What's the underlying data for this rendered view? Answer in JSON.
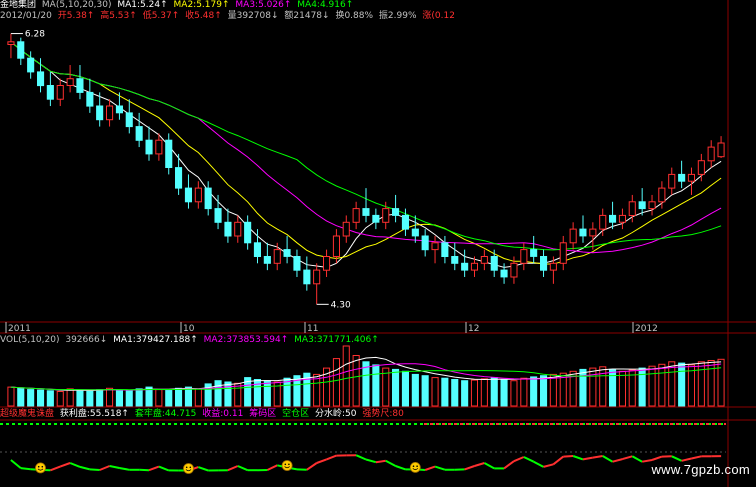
{
  "header": {
    "stock_name": "金地集团",
    "ma_label": "MA(5,10,20,30)",
    "ma_values": [
      {
        "text": "MA1:5.24↑",
        "color": "#ffffff"
      },
      {
        "text": "MA2:5.179↑",
        "color": "#ffff00"
      },
      {
        "text": "MA3:5.026↑",
        "color": "#ff00ff"
      },
      {
        "text": "MA4:4.916↑",
        "color": "#00ff00"
      }
    ]
  },
  "quote": {
    "date": "2012/01/20",
    "fields": [
      {
        "text": "开5.38↑",
        "color": "#ff3030"
      },
      {
        "text": "高5.53↑",
        "color": "#ff3030"
      },
      {
        "text": "低5.37↑",
        "color": "#ff3030"
      },
      {
        "text": "收5.48↑",
        "color": "#ff3030"
      },
      {
        "text": "量392708↓",
        "color": "#c0c0c0"
      },
      {
        "text": "额21478↓",
        "color": "#c0c0c0"
      },
      {
        "text": "换0.88%",
        "color": "#c0c0c0"
      },
      {
        "text": "振2.99%",
        "color": "#c0c0c0"
      },
      {
        "text": "涨(0.12",
        "color": "#ff3030"
      }
    ]
  },
  "price_annotations": {
    "high": "6.28",
    "low": "4.30"
  },
  "x_axis_labels": [
    {
      "text": "2011",
      "color": "#c0c0c0"
    },
    {
      "text": "10",
      "color": "#c0c0c0"
    },
    {
      "text": "11",
      "color": "#c0c0c0"
    },
    {
      "text": "12",
      "color": "#c0c0c0"
    },
    {
      "text": "2012",
      "color": "#c0c0c0"
    }
  ],
  "volume_header": {
    "label": "VOL(5,10,20)",
    "value": "392666↓",
    "ma_values": [
      {
        "text": "MA1:379427.188↑",
        "color": "#ffffff"
      },
      {
        "text": "MA2:373853.594↑",
        "color": "#ff00ff"
      },
      {
        "text": "MA3:371771.406↑",
        "color": "#00ff00"
      }
    ]
  },
  "indicator_header": {
    "items": [
      {
        "text": "超级魔鬼诛盘",
        "color": "#ff3030"
      },
      {
        "text": "获利盘:55.518↑",
        "color": "#ffffff"
      },
      {
        "text": "套牢盘:44.715",
        "color": "#00ff00"
      },
      {
        "text": "收益:0.11",
        "color": "#ff00ff"
      },
      {
        "text": "筹码区",
        "color": "#ff00ff"
      },
      {
        "text": "空仓区",
        "color": "#00ff00"
      },
      {
        "text": "分水岭:50",
        "color": "#ffffff"
      },
      {
        "text": "强势尺:80",
        "color": "#ff3030"
      }
    ]
  },
  "colors": {
    "up": "#ff3030",
    "down": "#54ffff",
    "ma1": "#ffffff",
    "ma2": "#ffff00",
    "ma3": "#ff00ff",
    "ma4": "#00ff00",
    "grid": "#8b0000"
  },
  "watermark": "www.7gpzb.com",
  "chart_data": {
    "type": "candlestick",
    "ylim": [
      4.2,
      6.35
    ],
    "candles": [
      [
        6.2,
        6.28,
        6.1,
        6.22
      ],
      [
        6.22,
        6.25,
        6.05,
        6.1
      ],
      [
        6.1,
        6.15,
        5.95,
        6.0
      ],
      [
        6.0,
        6.1,
        5.85,
        5.9
      ],
      [
        5.9,
        6.0,
        5.75,
        5.8
      ],
      [
        5.8,
        5.95,
        5.75,
        5.9
      ],
      [
        5.9,
        6.05,
        5.85,
        5.95
      ],
      [
        5.95,
        6.05,
        5.8,
        5.85
      ],
      [
        5.85,
        5.95,
        5.7,
        5.75
      ],
      [
        5.75,
        5.85,
        5.6,
        5.65
      ],
      [
        5.65,
        5.8,
        5.6,
        5.75
      ],
      [
        5.75,
        5.85,
        5.65,
        5.7
      ],
      [
        5.7,
        5.8,
        5.55,
        5.6
      ],
      [
        5.6,
        5.7,
        5.45,
        5.5
      ],
      [
        5.5,
        5.6,
        5.35,
        5.4
      ],
      [
        5.4,
        5.55,
        5.35,
        5.5
      ],
      [
        5.5,
        5.55,
        5.25,
        5.3
      ],
      [
        5.3,
        5.4,
        5.1,
        5.15
      ],
      [
        5.15,
        5.25,
        5.0,
        5.05
      ],
      [
        5.05,
        5.2,
        5.0,
        5.15
      ],
      [
        5.15,
        5.2,
        4.95,
        5.0
      ],
      [
        5.0,
        5.1,
        4.85,
        4.9
      ],
      [
        4.9,
        5.0,
        4.75,
        4.8
      ],
      [
        4.8,
        4.95,
        4.75,
        4.9
      ],
      [
        4.9,
        4.95,
        4.7,
        4.75
      ],
      [
        4.75,
        4.85,
        4.6,
        4.65
      ],
      [
        4.65,
        4.75,
        4.55,
        4.6
      ],
      [
        4.6,
        4.75,
        4.55,
        4.7
      ],
      [
        4.7,
        4.8,
        4.6,
        4.65
      ],
      [
        4.65,
        4.7,
        4.5,
        4.55
      ],
      [
        4.55,
        4.65,
        4.4,
        4.45
      ],
      [
        4.45,
        4.6,
        4.3,
        4.55
      ],
      [
        4.55,
        4.7,
        4.5,
        4.65
      ],
      [
        4.65,
        4.85,
        4.6,
        4.8
      ],
      [
        4.8,
        4.95,
        4.75,
        4.9
      ],
      [
        4.9,
        5.05,
        4.85,
        5.0
      ],
      [
        5.0,
        5.15,
        4.9,
        4.95
      ],
      [
        4.95,
        5.0,
        4.85,
        4.9
      ],
      [
        4.9,
        5.05,
        4.85,
        5.0
      ],
      [
        5.0,
        5.1,
        4.9,
        4.95
      ],
      [
        4.95,
        5.0,
        4.8,
        4.85
      ],
      [
        4.85,
        4.95,
        4.75,
        4.8
      ],
      [
        4.8,
        4.85,
        4.65,
        4.7
      ],
      [
        4.7,
        4.8,
        4.6,
        4.75
      ],
      [
        4.75,
        4.8,
        4.6,
        4.65
      ],
      [
        4.65,
        4.75,
        4.55,
        4.6
      ],
      [
        4.6,
        4.7,
        4.5,
        4.55
      ],
      [
        4.55,
        4.65,
        4.5,
        4.6
      ],
      [
        4.6,
        4.7,
        4.55,
        4.65
      ],
      [
        4.65,
        4.7,
        4.5,
        4.55
      ],
      [
        4.55,
        4.6,
        4.45,
        4.5
      ],
      [
        4.5,
        4.65,
        4.45,
        4.6
      ],
      [
        4.6,
        4.75,
        4.55,
        4.7
      ],
      [
        4.7,
        4.8,
        4.6,
        4.65
      ],
      [
        4.65,
        4.7,
        4.5,
        4.55
      ],
      [
        4.55,
        4.65,
        4.45,
        4.6
      ],
      [
        4.6,
        4.8,
        4.55,
        4.75
      ],
      [
        4.75,
        4.9,
        4.7,
        4.85
      ],
      [
        4.85,
        4.95,
        4.75,
        4.8
      ],
      [
        4.8,
        4.9,
        4.7,
        4.85
      ],
      [
        4.85,
        5.0,
        4.8,
        4.95
      ],
      [
        4.95,
        5.05,
        4.85,
        4.9
      ],
      [
        4.9,
        5.0,
        4.85,
        4.95
      ],
      [
        4.95,
        5.1,
        4.9,
        5.05
      ],
      [
        5.05,
        5.15,
        4.95,
        5.0
      ],
      [
        5.0,
        5.1,
        4.95,
        5.05
      ],
      [
        5.05,
        5.2,
        5.0,
        5.15
      ],
      [
        5.15,
        5.3,
        5.1,
        5.25
      ],
      [
        5.25,
        5.35,
        5.15,
        5.2
      ],
      [
        5.2,
        5.3,
        5.1,
        5.25
      ],
      [
        5.25,
        5.4,
        5.2,
        5.35
      ],
      [
        5.35,
        5.5,
        5.3,
        5.45
      ],
      [
        5.38,
        5.53,
        5.37,
        5.48
      ]
    ],
    "volume": [
      30,
      28,
      26,
      25,
      24,
      23,
      27,
      25,
      24,
      26,
      28,
      25,
      24,
      27,
      30,
      26,
      25,
      28,
      30,
      27,
      35,
      40,
      38,
      36,
      45,
      42,
      40,
      38,
      44,
      48,
      52,
      50,
      60,
      75,
      95,
      80,
      70,
      65,
      60,
      58,
      55,
      50,
      48,
      45,
      44,
      42,
      40,
      41,
      43,
      45,
      42,
      40,
      44,
      46,
      48,
      50,
      52,
      55,
      58,
      60,
      62,
      58,
      55,
      57,
      60,
      63,
      66,
      70,
      68,
      65,
      70,
      72,
      74
    ]
  }
}
